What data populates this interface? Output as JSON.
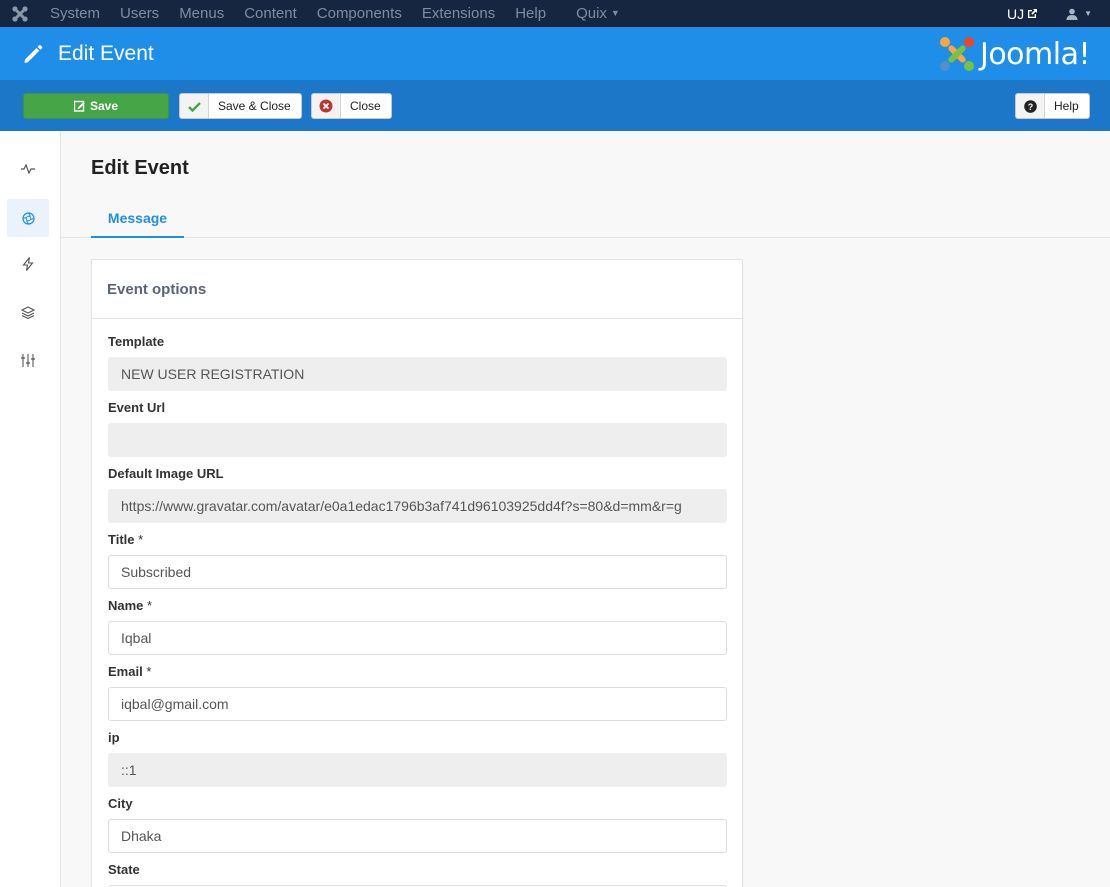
{
  "topnav": {
    "items": [
      "System",
      "Users",
      "Menus",
      "Content",
      "Components",
      "Extensions",
      "Help",
      "Quix"
    ],
    "site_label": "UJ"
  },
  "titlebar": {
    "title": "Edit Event",
    "brand": "Joomla!"
  },
  "toolbar": {
    "save": "Save",
    "save_close": "Save & Close",
    "close": "Close",
    "help": "Help"
  },
  "sidebar": {
    "icons": [
      "pulse-icon",
      "aperture-icon",
      "lightning-icon",
      "layers-icon",
      "sliders-icon"
    ],
    "active_index": 1
  },
  "page": {
    "title": "Edit Event",
    "tab": "Message"
  },
  "card": {
    "title": "Event options",
    "fields": {
      "template": {
        "label": "Template",
        "value": "NEW USER REGISTRATION"
      },
      "event_url": {
        "label": "Event Url",
        "value": ""
      },
      "default_image_url": {
        "label": "Default Image URL",
        "value": "https://www.gravatar.com/avatar/e0a1edac1796b3af741d96103925dd4f?s=80&d=mm&r=g"
      },
      "title": {
        "label": "Title",
        "value": "Subscribed"
      },
      "name": {
        "label": "Name",
        "value": "Iqbal"
      },
      "email": {
        "label": "Email",
        "value": "iqbal@gmail.com"
      },
      "ip": {
        "label": "ip",
        "value": "::1"
      },
      "city": {
        "label": "City",
        "value": "Dhaka"
      },
      "state": {
        "label": "State",
        "value": ""
      }
    },
    "required_marker": "*"
  },
  "colors": {
    "topnav": "#172640",
    "titlebar": "#1f8ee8",
    "toolbar": "#1c77c8",
    "save": "#46a546"
  }
}
